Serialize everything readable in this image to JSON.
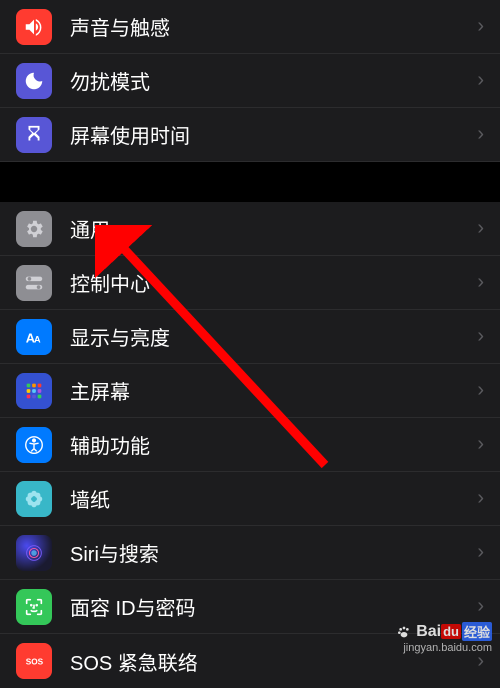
{
  "settings": {
    "group1": [
      {
        "key": "sounds",
        "label": "声音与触感",
        "bg": "#ff3b30"
      },
      {
        "key": "dnd",
        "label": "勿扰模式",
        "bg": "#5856d6"
      },
      {
        "key": "screentime",
        "label": "屏幕使用时间",
        "bg": "#5856d6"
      }
    ],
    "group2": [
      {
        "key": "general",
        "label": "通用",
        "bg": "#8e8e93"
      },
      {
        "key": "controlcenter",
        "label": "控制中心",
        "bg": "#8e8e93"
      },
      {
        "key": "display",
        "label": "显示与亮度",
        "bg": "#007aff"
      },
      {
        "key": "homescreen",
        "label": "主屏幕",
        "bg": "#3451d1"
      },
      {
        "key": "accessibility",
        "label": "辅助功能",
        "bg": "#007aff"
      },
      {
        "key": "wallpaper",
        "label": "墙纸",
        "bg": "#38b7c8"
      },
      {
        "key": "siri",
        "label": "Siri与搜索",
        "bg": "#1a1a2e"
      },
      {
        "key": "faceid",
        "label": "面容 ID与密码",
        "bg": "#34c759"
      },
      {
        "key": "sos",
        "label": "SOS 紧急联络",
        "bg": "#ff3b30"
      }
    ]
  },
  "watermark": {
    "brand_prefix": "Bai",
    "brand_red": "du",
    "brand_blue": "经验",
    "url": "jingyan.baidu.com"
  },
  "annotation": {
    "arrow_color": "#ff0000",
    "target": "general"
  }
}
